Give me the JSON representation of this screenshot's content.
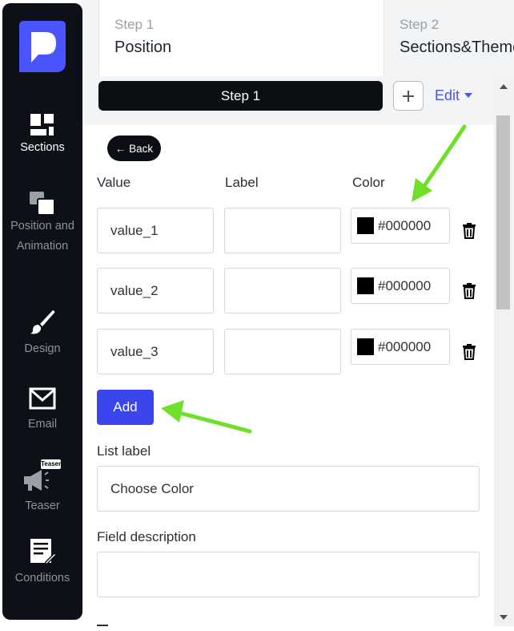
{
  "sidebar": {
    "items": [
      {
        "label": "Sections",
        "icon": "sections-icon",
        "active": true
      },
      {
        "label": "Position and Animation",
        "icon": "position-icon",
        "active": false
      },
      {
        "label": "Design",
        "icon": "brush-icon",
        "active": false
      },
      {
        "label": "Email",
        "icon": "envelope-icon",
        "active": false
      },
      {
        "label": "Teaser",
        "icon": "megaphone-icon",
        "badge": "Teaser",
        "active": false
      },
      {
        "label": "Conditions",
        "icon": "conditions-icon",
        "active": false
      }
    ]
  },
  "steps": [
    {
      "number": "Step 1",
      "name": "Position"
    },
    {
      "number": "Step 2",
      "name": "Sections&Theme"
    }
  ],
  "toolbar": {
    "current_step": "Step 1",
    "edit_label": "Edit"
  },
  "form": {
    "back_label": "← Back",
    "columns": {
      "value": "Value",
      "label": "Label",
      "color": "Color"
    },
    "rows": [
      {
        "value": "value_1",
        "label": "",
        "color": "#000000"
      },
      {
        "value": "value_2",
        "label": "",
        "color": "#000000"
      },
      {
        "value": "value_3",
        "label": "",
        "color": "#000000"
      }
    ],
    "add_label": "Add",
    "list_label": {
      "label": "List label",
      "value": "Choose Color"
    },
    "field_description": {
      "label": "Field description",
      "value": ""
    }
  },
  "colors": {
    "sidebar_bg": "#0d1117",
    "accent": "#3b45ee",
    "annotation_arrow": "#6ee02a"
  }
}
